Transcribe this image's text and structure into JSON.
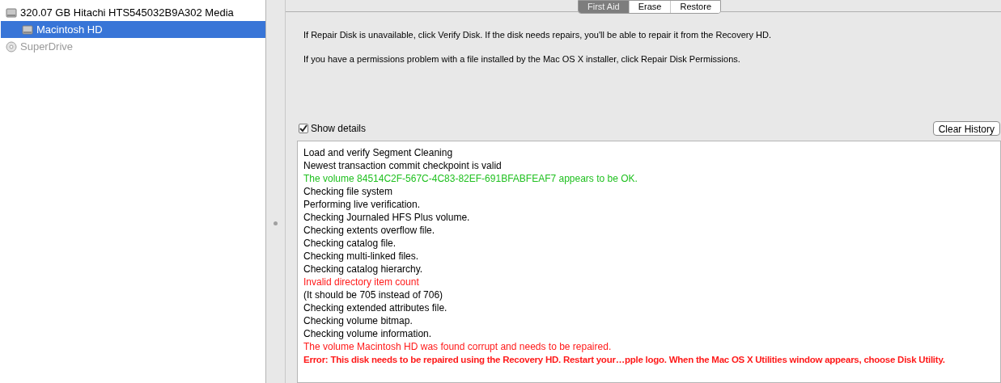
{
  "sidebar": {
    "items": [
      {
        "label": "320.07 GB Hitachi HTS545032B9A302 Media",
        "kind": "disk",
        "selected": false,
        "disabled": false,
        "children": [
          {
            "label": "Macintosh HD",
            "kind": "disk",
            "selected": true,
            "disabled": false
          }
        ]
      },
      {
        "label": "SuperDrive",
        "kind": "optical",
        "selected": false,
        "disabled": true
      }
    ]
  },
  "tabs": [
    {
      "label": "First Aid",
      "selected": true
    },
    {
      "label": "Erase",
      "selected": false
    },
    {
      "label": "Restore",
      "selected": false
    }
  ],
  "info": [
    "If Repair Disk is unavailable, click Verify Disk. If the disk needs repairs, you'll be able to repair it from the Recovery HD.",
    "If you have a permissions problem with a file installed by the Mac OS X installer, click Repair Disk Permissions."
  ],
  "show_details": {
    "label": "Show details",
    "checked": true
  },
  "clear_button": "Clear History",
  "log": [
    {
      "text": "Load and verify Segment Cleaning",
      "kind": "normal"
    },
    {
      "text": "Newest transaction commit checkpoint is valid",
      "kind": "normal"
    },
    {
      "text": "The volume 84514C2F-567C-4C83-82EF-691BFABFEAF7 appears to be OK.",
      "kind": "ok"
    },
    {
      "text": "Checking file system",
      "kind": "normal"
    },
    {
      "text": "Performing live verification.",
      "kind": "normal"
    },
    {
      "text": "Checking Journaled HFS Plus volume.",
      "kind": "normal"
    },
    {
      "text": "Checking extents overflow file.",
      "kind": "normal"
    },
    {
      "text": "Checking catalog file.",
      "kind": "normal"
    },
    {
      "text": "Checking multi-linked files.",
      "kind": "normal"
    },
    {
      "text": "Checking catalog hierarchy.",
      "kind": "normal"
    },
    {
      "text": "Invalid directory item count",
      "kind": "error"
    },
    {
      "text": "(It should be 705 instead of 706)",
      "kind": "normal"
    },
    {
      "text": "Checking extended attributes file.",
      "kind": "normal"
    },
    {
      "text": "Checking volume bitmap.",
      "kind": "normal"
    },
    {
      "text": "Checking volume information.",
      "kind": "normal"
    },
    {
      "text": "The volume Macintosh HD was found corrupt and needs to be repaired.",
      "kind": "error"
    },
    {
      "text": "Error: This disk needs to be repaired using the Recovery HD. Restart your…pple logo. When the Mac OS X Utilities window appears, choose Disk Utility.",
      "kind": "fatal"
    }
  ]
}
